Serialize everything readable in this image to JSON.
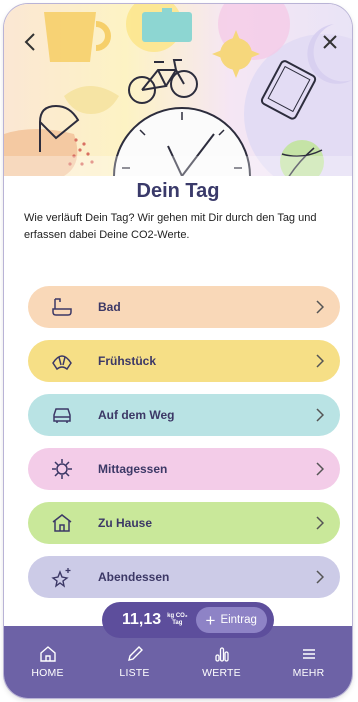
{
  "header": {
    "title": "Dein Tag",
    "intro": "Wie verläuft Dein Tag? Wir gehen mit Dir durch den Tag und erfassen dabei Deine CO2-Werte."
  },
  "icons": {
    "back": "chevron-left-icon",
    "close": "close-icon"
  },
  "categories": [
    {
      "label": "Bad",
      "icon": "shower-icon",
      "color": "#f9d8b8"
    },
    {
      "label": "Frühstück",
      "icon": "croissant-icon",
      "color": "#f6df86"
    },
    {
      "label": "Auf dem Weg",
      "icon": "car-icon",
      "color": "#b9e3e4"
    },
    {
      "label": "Mittagessen",
      "icon": "sun-icon",
      "color": "#f3cce8"
    },
    {
      "label": "Zu Hause",
      "icon": "house-icon",
      "color": "#c9e89a"
    },
    {
      "label": "Abendessen",
      "icon": "stars-icon",
      "color": "#cccbe7"
    }
  ],
  "co2": {
    "value": "11,13",
    "unit_top": "kg CO₂",
    "unit_bottom": "Tag",
    "add_label": "Eintrag"
  },
  "tabs": [
    {
      "label": "HOME",
      "icon": "home-icon"
    },
    {
      "label": "LISTE",
      "icon": "pencil-icon"
    },
    {
      "label": "WERTE",
      "icon": "chart-icon"
    },
    {
      "label": "MEHR",
      "icon": "menu-icon"
    }
  ],
  "colors": {
    "accent": "#6d62a6",
    "pill": "#5d4e9c",
    "add_button": "#8e83c6",
    "title": "#3a3a6a"
  }
}
